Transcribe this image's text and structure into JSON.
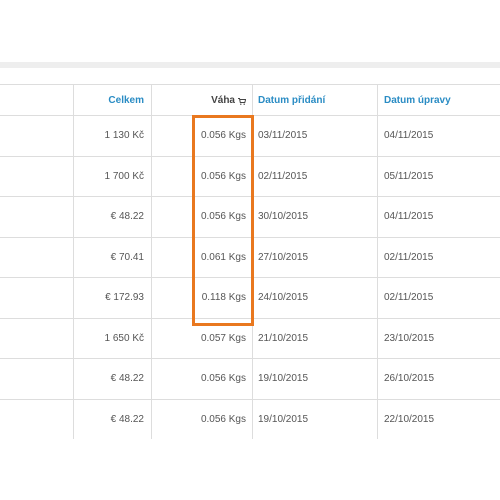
{
  "header": {
    "celkem": "Celkem",
    "vaha": "Váha",
    "datum_pridani": "Datum přidání",
    "datum_upravy": "Datum úpravy"
  },
  "rows": [
    {
      "celkem": "1 130 Kč",
      "vaha": "0.056 Kgs",
      "pridani": "03/11/2015",
      "upravy": "04/11/2015"
    },
    {
      "celkem": "1 700 Kč",
      "vaha": "0.056 Kgs",
      "pridani": "02/11/2015",
      "upravy": "05/11/2015"
    },
    {
      "celkem": "€ 48.22",
      "vaha": "0.056 Kgs",
      "pridani": "30/10/2015",
      "upravy": "04/11/2015"
    },
    {
      "celkem": "€ 70.41",
      "vaha": "0.061 Kgs",
      "pridani": "27/10/2015",
      "upravy": "02/11/2015"
    },
    {
      "celkem": "€ 172.93",
      "vaha": "0.118 Kgs",
      "pridani": "24/10/2015",
      "upravy": "02/11/2015"
    },
    {
      "celkem": "1 650 Kč",
      "vaha": "0.057 Kgs",
      "pridani": "21/10/2015",
      "upravy": "23/10/2015"
    },
    {
      "celkem": "€ 48.22",
      "vaha": "0.056 Kgs",
      "pridani": "19/10/2015",
      "upravy": "26/10/2015"
    },
    {
      "celkem": "€ 48.22",
      "vaha": "0.056 Kgs",
      "pridani": "19/10/2015",
      "upravy": "22/10/2015"
    }
  ],
  "icons": {
    "vaha_header": "shopping-cart-icon"
  },
  "colors": {
    "link_header": "#2a8cc4",
    "highlight": "#e9781f"
  }
}
